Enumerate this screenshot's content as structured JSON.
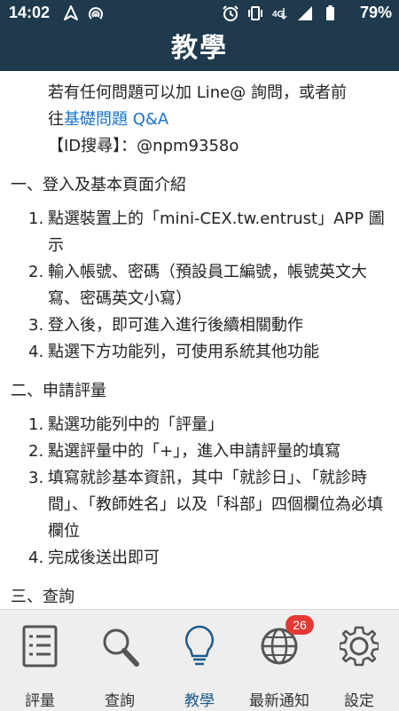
{
  "status_bar": {
    "time": "14:02",
    "battery": "79%",
    "left_icons": [
      "nav-arrow-icon",
      "hotspot-icon"
    ],
    "right_icons": [
      "alarm-icon",
      "vibrate-icon",
      "4g-icon",
      "signal-icon",
      "battery-icon"
    ]
  },
  "app_bar": {
    "title": "教學"
  },
  "intro": {
    "line1": "若有任何問題可以加 Line@ 詢問，或者前",
    "line2_prefix": "往",
    "link": "基礎問題 Q&A",
    "id_label": "【ID搜尋】：@npm9358o"
  },
  "sections": [
    {
      "heading": "一、登入及基本頁面介紹",
      "steps": [
        {
          "num": "1.",
          "text": "點選裝置上的「mini-CEX.tw.entrust」APP 圖示"
        },
        {
          "num": "2.",
          "text": "輸入帳號、密碼（預設員工編號，帳號英文大寫、密碼英文小寫）"
        },
        {
          "num": "3.",
          "text": "登入後，即可進入進行後續相關動作"
        },
        {
          "num": "4.",
          "text": "點選下方功能列，可使用系統其他功能"
        }
      ]
    },
    {
      "heading": "二、申請評量",
      "steps": [
        {
          "num": "1.",
          "text": "點選功能列中的「評量」"
        },
        {
          "num": "2.",
          "text": "點選評量中的「+」，進入申請評量的填寫"
        },
        {
          "num": "3.",
          "text": "填寫就診基本資訊，其中「就診日」、「就診時間」、「教師姓名」以及「科部」四個欄位為必填欄位"
        },
        {
          "num": "4.",
          "text": "完成後送出即可"
        }
      ]
    },
    {
      "heading": "三、查詢",
      "steps": []
    }
  ],
  "bottom_nav": {
    "items": [
      {
        "label": "評量",
        "icon": "clipboard-icon",
        "active": false
      },
      {
        "label": "查詢",
        "icon": "magnifier-icon",
        "active": false
      },
      {
        "label": "教學",
        "icon": "lightbulb-icon",
        "active": true
      },
      {
        "label": "最新通知",
        "icon": "globe-icon",
        "active": false,
        "badge": "26"
      },
      {
        "label": "設定",
        "icon": "gear-icon",
        "active": false
      }
    ],
    "active_color": "#1c5a8b",
    "badge_color": "#e53935"
  },
  "colors": {
    "app_bar": "#1f3a4d",
    "link": "#1a73c9"
  }
}
